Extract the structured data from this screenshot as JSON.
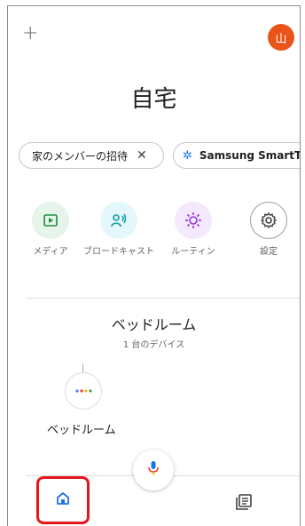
{
  "header": {
    "add_label": "+",
    "avatar_letter": "山",
    "avatar_color": "#e8541a"
  },
  "home": {
    "title": "自宅"
  },
  "chips": [
    {
      "label": "家のメンバーの招待",
      "close": "✕"
    },
    {
      "label": "Samsung SmartThin",
      "icon": "snowflake-icon"
    }
  ],
  "actions": [
    {
      "label": "メディア",
      "icon": "play-icon",
      "color": "#1e8e3e"
    },
    {
      "label": "ブロードキャスト",
      "icon": "broadcast-icon",
      "color": "#129eaf"
    },
    {
      "label": "ルーティン",
      "icon": "routine-icon",
      "color": "#9334e6"
    },
    {
      "label": "設定",
      "icon": "gear-icon",
      "color": "#3c4043"
    }
  ],
  "room": {
    "name": "ベッドルーム",
    "count": "1 台のデバイス"
  },
  "devices": [
    {
      "name": "ベッドルーム",
      "icon": "smart-speaker-icon"
    }
  ],
  "nav": {
    "home_icon": "home-icon",
    "feed_icon": "feed-icon",
    "mic_icon": "mic-icon",
    "home_color": "#1a73e8"
  }
}
